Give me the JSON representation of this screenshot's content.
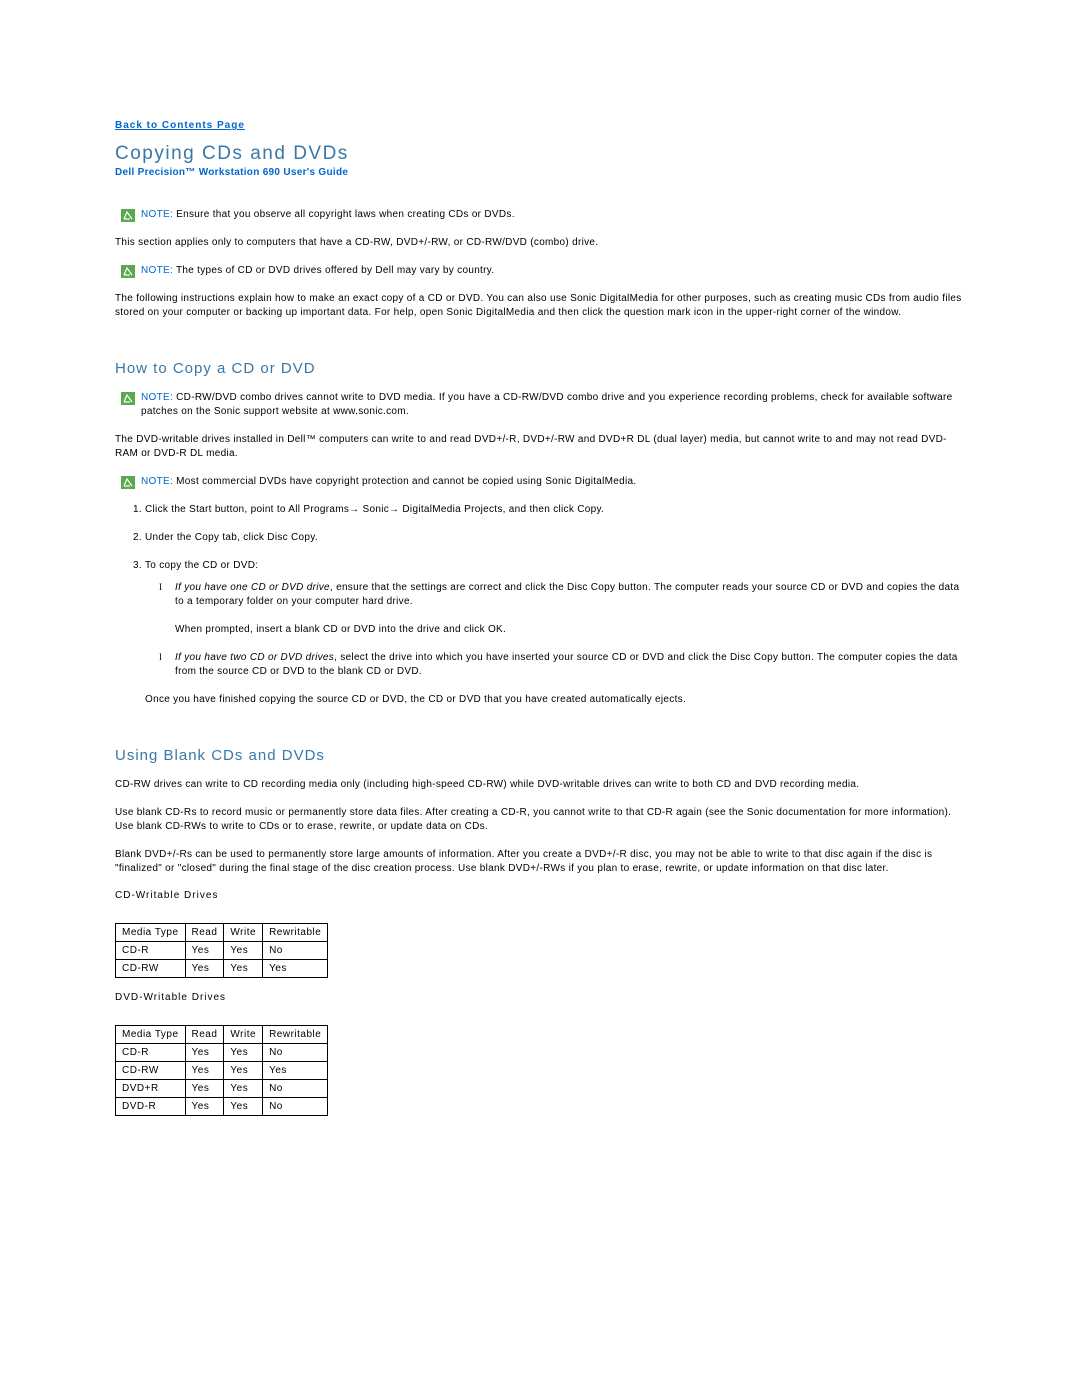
{
  "back_link": "Back to Contents Page",
  "page_title": "Copying CDs and DVDs",
  "subtitle": "Dell Precision™ Workstation 690 User's Guide",
  "note_label": "NOTE:",
  "intro": {
    "note1": "Ensure that you observe all copyright laws when creating CDs or DVDs.",
    "para1": "This section applies only to computers that have a CD-RW, DVD+/-RW, or CD-RW/DVD (combo) drive.",
    "note2": "The types of CD or DVD drives offered by Dell may vary by country.",
    "para2": "The following instructions explain how to make an exact copy of a CD or DVD. You can also use Sonic DigitalMedia for other purposes, such as creating music CDs from audio files stored on your computer or backing up important data. For help, open Sonic DigitalMedia and then click the question mark icon in the upper-right corner of the window."
  },
  "section1": {
    "heading": "How to Copy a CD or DVD",
    "note1": "CD-RW/DVD combo drives cannot write to DVD media. If you have a CD-RW/DVD combo drive and you experience recording problems, check for available software patches on the Sonic support website at www.sonic.com.",
    "para1": "The DVD-writable drives installed in Dell™ computers can write to and read DVD+/-R, DVD+/-RW and DVD+R DL (dual layer) media, but cannot write to and may not read DVD-RAM or DVD-R DL media.",
    "note2": "Most commercial DVDs have copyright protection and cannot be copied using Sonic DigitalMedia.",
    "steps": {
      "s1": "Click the Start button, point to All Programs→ Sonic→ DigitalMedia Projects, and then click Copy.",
      "s2": "Under the Copy tab, click Disc Copy.",
      "s3": "To copy the CD or DVD:",
      "s3a_em": "If you have one CD or DVD drive",
      "s3a": ", ensure that the settings are correct and click the Disc Copy button. The computer reads your source CD or DVD and copies the data to a temporary folder on your computer hard drive.",
      "s3a2": "When prompted, insert a blank CD or DVD into the drive and click OK.",
      "s3b_em": "If you have two CD or DVD drives",
      "s3b": ", select the drive into which you have inserted your source CD or DVD and click the Disc Copy button. The computer copies the data from the source CD or DVD to the blank CD or DVD.",
      "after": "Once you have finished copying the source CD or DVD, the CD or DVD that you have created automatically ejects."
    }
  },
  "section2": {
    "heading": "Using Blank CDs and DVDs",
    "para1": "CD-RW drives can write to CD recording media only (including high-speed CD-RW) while DVD-writable drives can write to both CD and DVD recording media.",
    "para2": "Use blank CD-Rs to record music or permanently store data files. After creating a CD-R, you cannot write to that CD-R again (see the Sonic documentation for more information). Use blank CD-RWs to write to CDs or to erase, rewrite, or update data on CDs.",
    "para3": "Blank DVD+/-Rs can be used to permanently store large amounts of information. After you create a DVD+/-R disc, you may not be able to write to that disc again if the disc is \"finalized\" or \"closed\" during the final stage of the disc creation process. Use blank DVD+/-RWs if you plan to erase, rewrite, or update information on that disc later."
  },
  "tables": {
    "cd_heading": "CD-Writable Drives",
    "dvd_heading": "DVD-Writable Drives",
    "headers": {
      "media_type": "Media Type",
      "read": "Read",
      "write": "Write",
      "rewritable": "Rewritable"
    },
    "cd_rows": [
      {
        "media": "CD-R",
        "read": "Yes",
        "write": "Yes",
        "rewritable": "No"
      },
      {
        "media": "CD-RW",
        "read": "Yes",
        "write": "Yes",
        "rewritable": "Yes"
      }
    ],
    "dvd_rows": [
      {
        "media": "CD-R",
        "read": "Yes",
        "write": "Yes",
        "rewritable": "No"
      },
      {
        "media": "CD-RW",
        "read": "Yes",
        "write": "Yes",
        "rewritable": "Yes"
      },
      {
        "media": "DVD+R",
        "read": "Yes",
        "write": "Yes",
        "rewritable": "No"
      },
      {
        "media": "DVD-R",
        "read": "Yes",
        "write": "Yes",
        "rewritable": "No"
      }
    ]
  }
}
